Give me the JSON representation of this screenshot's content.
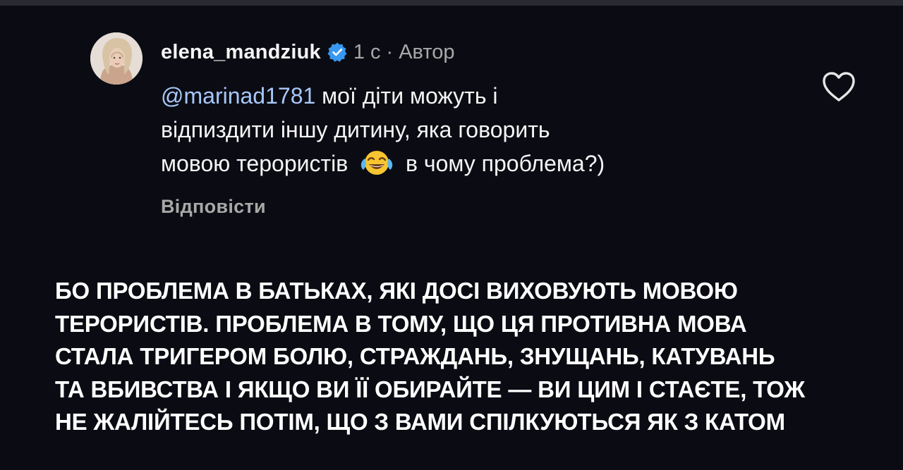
{
  "comment": {
    "username": "elena_mandziuk",
    "verified_icon": "verified-badge-icon",
    "time": "1 с",
    "separator": "·",
    "author_label": "Автор",
    "mention": "@marinad1781",
    "text_line1": " мої діти можуть і",
    "text_line2": "відпиздити іншу дитину, яка говорить",
    "text_line3_before_emoji": "мовою терористів",
    "emoji": "face-with-tears-of-joy-emoji",
    "text_line3_after_emoji": "в чому проблема?)",
    "reply_label": "Відповісти",
    "like_icon": "heart-outline-icon"
  },
  "caption": {
    "lines": [
      "БО ПРОБЛЕМА В БАТЬКАХ, ЯКІ ДОСІ ВИХОВУЮТЬ МОВОЮ",
      "ТЕРОРИСТІВ. ПРОБЛЕМА В ТОМУ, ЩО ЦЯ ПРОТИВНА МОВА",
      "СТАЛА ТРИГЕРОМ БОЛЮ, СТРАЖДАНЬ, ЗНУЩАНЬ, КАТУВАНЬ",
      "ТА ВБИВСТВА І ЯКЩО ВИ ЇЇ ОБИРАЙТЕ — ВИ ЦИМ І СТАЄТЕ, ТОЖ",
      "НЕ ЖАЛІЙТЕСЬ ПОТІМ, ЩО З ВАМИ СПІЛКУЮТЬСЯ ЯК З КАТОМ"
    ]
  },
  "colors": {
    "background": "#0b0c13",
    "mention": "#a8c7fa",
    "secondary_text": "#a8a8a8",
    "verified": "#3897f0"
  }
}
